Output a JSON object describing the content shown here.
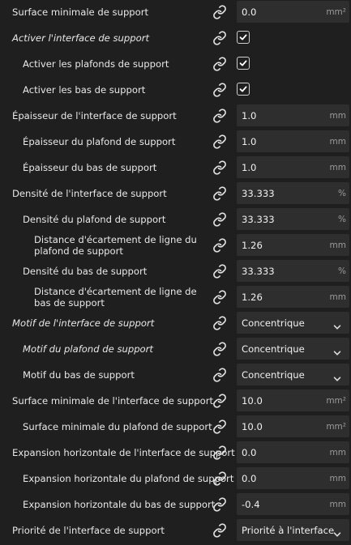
{
  "rows": [
    {
      "label": "Surface minimale de support",
      "italic": false,
      "indent": 0,
      "type": "input",
      "value": "0.0",
      "unit": "mm²"
    },
    {
      "label": "Activer l'interface de support",
      "italic": true,
      "indent": 0,
      "type": "checkbox",
      "checked": true
    },
    {
      "label": "Activer les plafonds de support",
      "italic": false,
      "indent": 1,
      "type": "checkbox",
      "checked": true
    },
    {
      "label": "Activer les bas de support",
      "italic": false,
      "indent": 1,
      "type": "checkbox",
      "checked": true
    },
    {
      "label": "Épaisseur de l'interface de support",
      "italic": false,
      "indent": 0,
      "type": "input",
      "value": "1.0",
      "unit": "mm"
    },
    {
      "label": "Épaisseur du plafond de support",
      "italic": false,
      "indent": 1,
      "type": "input",
      "value": "1.0",
      "unit": "mm"
    },
    {
      "label": "Épaisseur du bas de support",
      "italic": false,
      "indent": 1,
      "type": "input",
      "value": "1.0",
      "unit": "mm"
    },
    {
      "label": "Densité de l'interface de support",
      "italic": false,
      "indent": 0,
      "type": "input",
      "value": "33.333",
      "unit": "%"
    },
    {
      "label": "Densité du plafond de support",
      "italic": false,
      "indent": 1,
      "type": "input",
      "value": "33.333",
      "unit": "%"
    },
    {
      "label": "Distance d'écartement de ligne du plafond de support",
      "italic": false,
      "indent": 2,
      "type": "input",
      "value": "1.26",
      "unit": "mm"
    },
    {
      "label": "Densité du bas de support",
      "italic": false,
      "indent": 1,
      "type": "input",
      "value": "33.333",
      "unit": "%"
    },
    {
      "label": "Distance d'écartement de ligne de bas de support",
      "italic": false,
      "indent": 2,
      "type": "input",
      "value": "1.26",
      "unit": "mm"
    },
    {
      "label": "Motif de l'interface de support",
      "italic": true,
      "indent": 0,
      "type": "select",
      "value": "Concentrique"
    },
    {
      "label": "Motif du plafond de support",
      "italic": true,
      "indent": 1,
      "type": "select",
      "value": "Concentrique"
    },
    {
      "label": "Motif du bas de support",
      "italic": false,
      "indent": 1,
      "type": "select",
      "value": "Concentrique"
    },
    {
      "label": "Surface minimale de l'interface de support",
      "italic": false,
      "indent": 0,
      "type": "input",
      "value": "10.0",
      "unit": "mm²"
    },
    {
      "label": "Surface minimale du plafond de support",
      "italic": false,
      "indent": 1,
      "type": "input",
      "value": "10.0",
      "unit": "mm²"
    },
    {
      "label": "Expansion horizontale de l'interface de support",
      "italic": false,
      "indent": 0,
      "type": "input",
      "value": "0.0",
      "unit": "mm"
    },
    {
      "label": "Expansion horizontale du plafond de support",
      "italic": false,
      "indent": 1,
      "type": "input",
      "value": "0.0",
      "unit": "mm"
    },
    {
      "label": "Expansion horizontale du bas de support",
      "italic": false,
      "indent": 1,
      "type": "input",
      "value": "-0.4",
      "unit": "mm"
    },
    {
      "label": "Priorité de l'interface de support",
      "italic": false,
      "indent": 0,
      "type": "select",
      "value": "Priorité à l'interface"
    }
  ],
  "icons": {
    "link": "link-icon",
    "dropdown": "chevron-down-icon",
    "check": "checkmark-icon"
  },
  "colors": {
    "background": "#1f1f1f",
    "field": "#2e2e2e",
    "text": "#e8e8e8",
    "unit": "#9a9a9a"
  }
}
